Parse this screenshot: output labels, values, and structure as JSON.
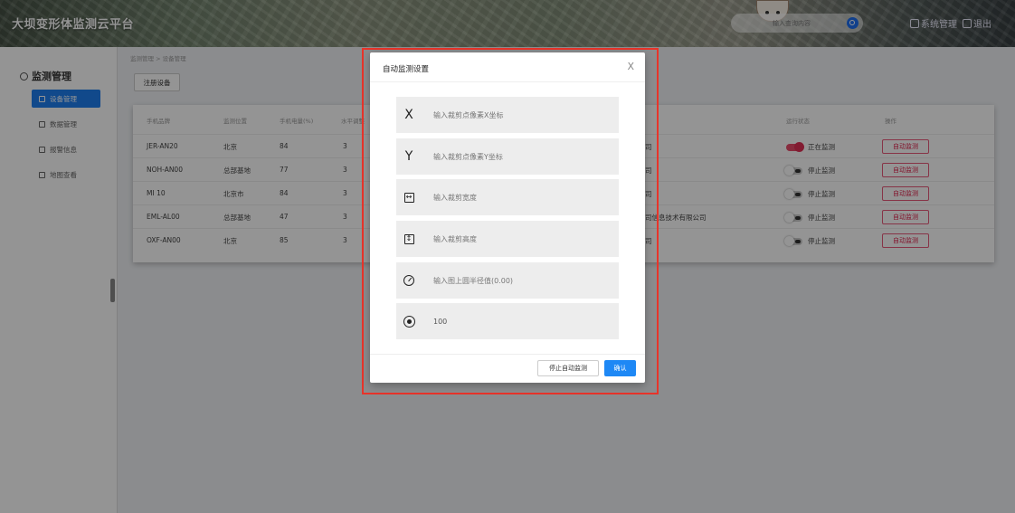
{
  "header": {
    "title": "大坝变形体监测云平台",
    "search_placeholder": "输入查询内容",
    "system_admin": "系统管理",
    "logout": "退出"
  },
  "sidebar": {
    "section": "监测管理",
    "items": [
      {
        "label": "设备管理",
        "icon": "device-icon"
      },
      {
        "label": "数据管理",
        "icon": "chart-icon"
      },
      {
        "label": "报警信息",
        "icon": "alarm-icon"
      },
      {
        "label": "地图查看",
        "icon": "map-icon"
      }
    ]
  },
  "breadcrumb": "监测管理 > 设备管理",
  "register_button": "注册设备",
  "table": {
    "headers": [
      "手机品牌",
      "监测位置",
      "手机电量(%)",
      "水平调整",
      "运行状态",
      "操作"
    ],
    "rows": [
      {
        "brand": "JER-AN20",
        "location": "北京",
        "battery": "84",
        "level": "3",
        "fragment": "司",
        "status": "正在监测",
        "running": true,
        "op": "自动监测"
      },
      {
        "brand": "NOH-AN00",
        "location": "总部基地",
        "battery": "77",
        "level": "3",
        "fragment": "司",
        "status": "停止监测",
        "running": false,
        "op": "自动监测"
      },
      {
        "brand": "MI 10",
        "location": "北京市",
        "battery": "84",
        "level": "3",
        "fragment": "司",
        "status": "停止监测",
        "running": false,
        "op": "自动监测"
      },
      {
        "brand": "EML-AL00",
        "location": "总部基地",
        "battery": "47",
        "level": "3",
        "fragment": "司信息技术有限公司",
        "status": "停止监测",
        "running": false,
        "op": "自动监测"
      },
      {
        "brand": "OXF-AN00",
        "location": "北京",
        "battery": "85",
        "level": "3",
        "fragment": "司",
        "status": "停止监测",
        "running": false,
        "op": "自动监测"
      }
    ]
  },
  "modal": {
    "title": "自动监测设置",
    "close": "X",
    "fields": [
      {
        "icon": "x-axis-icon",
        "glyph": "X",
        "placeholder": "输入裁剪点像素X坐标",
        "value": ""
      },
      {
        "icon": "y-axis-icon",
        "glyph": "Y",
        "placeholder": "输入裁剪点像素Y坐标",
        "value": ""
      },
      {
        "icon": "width-icon",
        "glyph": "↔",
        "placeholder": "输入裁剪宽度",
        "value": ""
      },
      {
        "icon": "height-icon",
        "glyph": "↕",
        "placeholder": "输入裁剪高度",
        "value": ""
      },
      {
        "icon": "gauge-icon",
        "glyph": "",
        "placeholder": "输入图上圆半径值(0.00)",
        "value": ""
      },
      {
        "icon": "radio-target-icon",
        "glyph": "",
        "placeholder": "",
        "value": "100"
      }
    ],
    "stop_button": "停止自动监测",
    "confirm_button": "确认"
  },
  "colors": {
    "primary": "#1e88f5",
    "danger": "#e0204a",
    "highlight_border": "#e8342a"
  }
}
